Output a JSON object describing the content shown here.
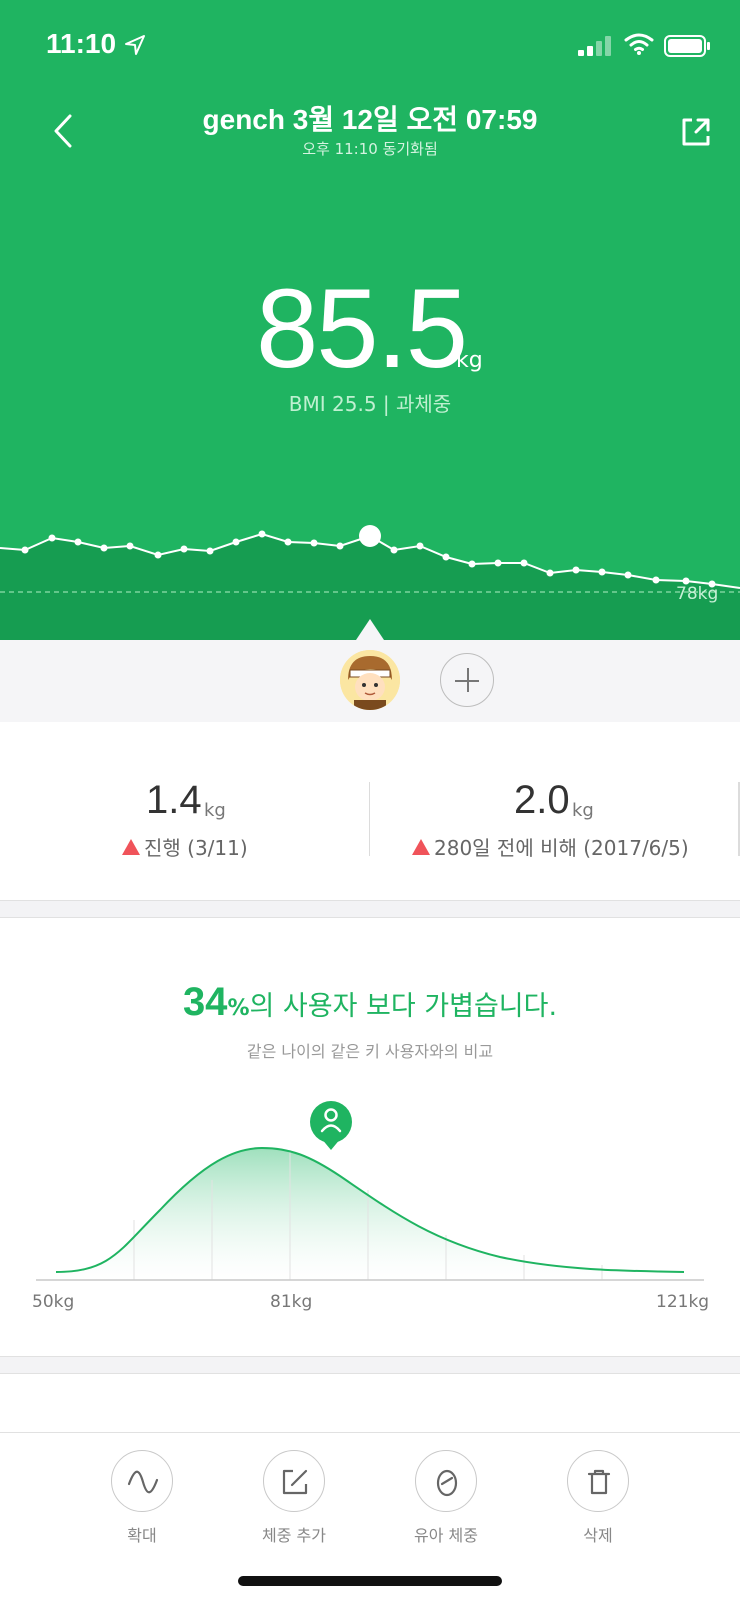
{
  "status_bar": {
    "time": "11:10"
  },
  "header": {
    "title": "gench 3월 12일 오전 07:59",
    "subtitle": "오후 11:10 동기화됨",
    "weight_value": "85.5",
    "weight_unit": "kg",
    "bmi_text": "BMI 25.5 | 과체중",
    "trend_reference_label": "78kg"
  },
  "stats": {
    "left": {
      "value": "1.4",
      "unit": "kg",
      "desc": "진행 (3/11)"
    },
    "right": {
      "value": "2.0",
      "unit": "kg",
      "desc": "280일 전에 비해 (2017/6/5)"
    }
  },
  "comparison": {
    "percent": "34",
    "percent_sign": "%",
    "title_rest": "의 사용자 보다 가볍습니다.",
    "subtitle": "같은 나이의 같은 키 사용자와의 비교",
    "axis_min": "50kg",
    "axis_mid": "81kg",
    "axis_max": "121kg"
  },
  "toolbar": {
    "zoom": "확대",
    "add_weight": "체중 추가",
    "baby_weight": "유아 체중",
    "delete": "삭제"
  },
  "colors": {
    "brand_green": "#1fb461",
    "warning_red": "#f0535a"
  },
  "icons": {
    "back": "chevron-left-icon",
    "share": "share-icon",
    "add_user": "plus-icon",
    "zoom": "wave-icon",
    "add_weight": "edit-icon",
    "baby_weight": "baby-icon",
    "delete": "trash-icon",
    "user_marker": "user-pin-icon"
  }
}
